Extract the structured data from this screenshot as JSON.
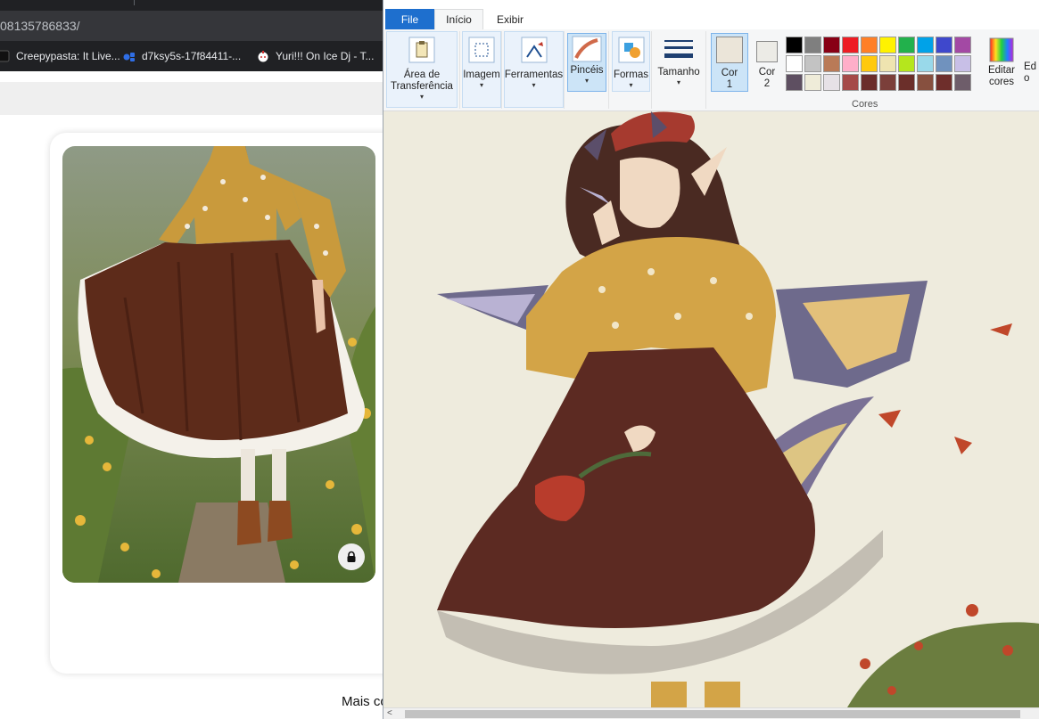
{
  "browser": {
    "url": "08135786833/",
    "bookmarks": [
      {
        "label": "Creepypasta: It Live...",
        "icon": "bookmark-favicon-icon"
      },
      {
        "label": "d7ksy5s-17f84411-...",
        "icon": "bookmark-favicon-icon"
      },
      {
        "label": "Yuri!!! On Ice Dj - T...",
        "icon": "bookmark-favicon-icon"
      }
    ],
    "more_text": "Mais co",
    "lock_icon": "lock-icon"
  },
  "paint": {
    "tabs": {
      "file": "File",
      "home": "Início",
      "view": "Exibir"
    },
    "ribbon": {
      "clipboard": "Área de Transferência",
      "image": "Imagem",
      "tools": "Ferramentas",
      "brushes": "Pincéis",
      "shapes": "Formas",
      "size": "Tamanho",
      "color1_line1": "Cor",
      "color1_line2": "1",
      "color2_line1": "Cor",
      "color2_line2": "2",
      "edit_colors_line1": "Editar",
      "edit_colors_line2": "cores",
      "cut_off_line1": "Ed",
      "cut_off_line2": "o",
      "colors_group": "Cores"
    },
    "color1": "#ebe5d9",
    "color2": "#ecebe6",
    "palette": [
      "#000000",
      "#7f7f7f",
      "#880015",
      "#ed1c24",
      "#ff7f27",
      "#fff200",
      "#22b14c",
      "#00a2e8",
      "#3f48cc",
      "#a349a4",
      "#ffffff",
      "#c3c3c3",
      "#b97a57",
      "#ffaec9",
      "#ffc90e",
      "#efe4b0",
      "#b5e61d",
      "#99d9ea",
      "#7092be",
      "#c8bfe7",
      "#5e4f61",
      "#efecd9",
      "#e6e1e6",
      "#a54a48",
      "#6b2d2a",
      "#7b3f3a",
      "#6b2f2a",
      "#87503f",
      "#6e2e2b",
      "#6e5d6a"
    ]
  }
}
